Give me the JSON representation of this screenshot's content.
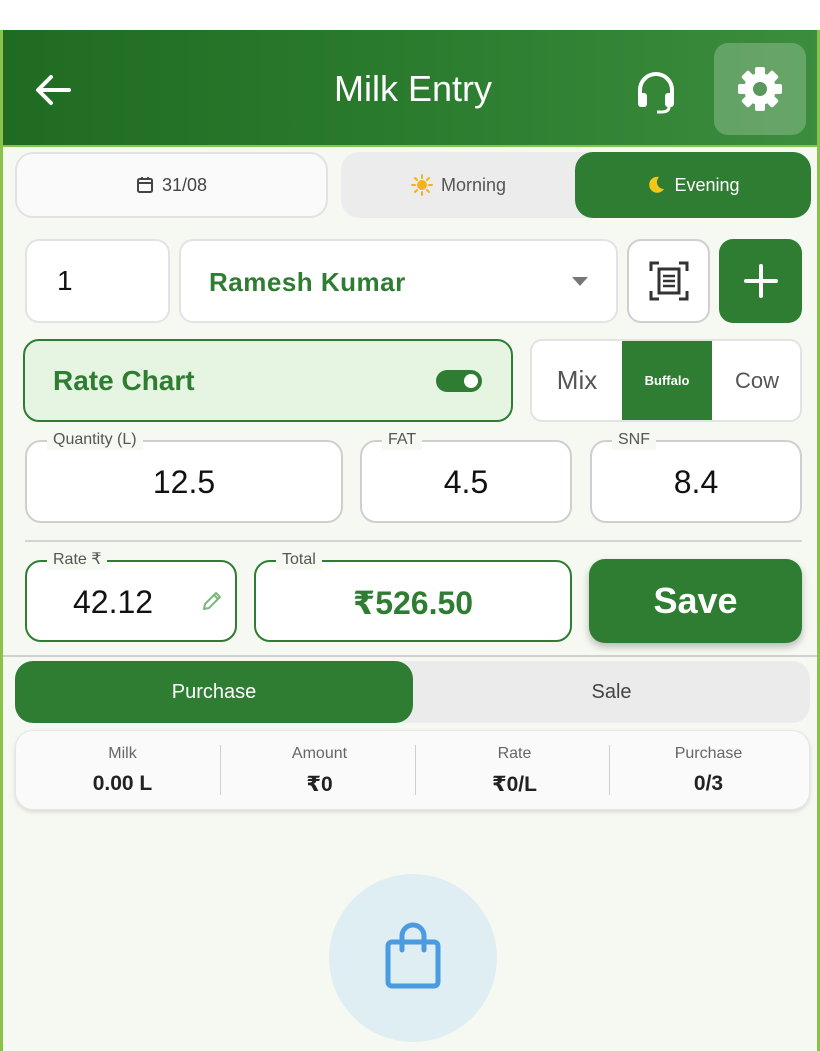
{
  "header": {
    "title": "Milk Entry"
  },
  "date": {
    "label": "31/08"
  },
  "shift": {
    "morning": "Morning",
    "evening": "Evening",
    "selected": "Evening"
  },
  "customer": {
    "number": "1",
    "name": "Ramesh Kumar"
  },
  "rate_chart": {
    "label": "Rate Chart",
    "enabled": true
  },
  "milk_type": {
    "options": [
      "Mix",
      "Buffalo",
      "Cow"
    ],
    "selected": "Buffalo"
  },
  "fields": {
    "quantity": {
      "label": "Quantity (L)",
      "value": "12.5"
    },
    "fat": {
      "label": "FAT",
      "value": "4.5"
    },
    "snf": {
      "label": "SNF",
      "value": "8.4"
    },
    "rate": {
      "label": "Rate ₹",
      "value": "42.12"
    },
    "total": {
      "label": "Total",
      "value": "₹526.50"
    }
  },
  "save_label": "Save",
  "tabs": {
    "purchase": "Purchase",
    "sale": "Sale",
    "selected": "Purchase"
  },
  "summary": [
    {
      "label": "Milk",
      "value": "0.00 L"
    },
    {
      "label": "Amount",
      "value": "₹0"
    },
    {
      "label": "Rate",
      "value": "₹0/L"
    },
    {
      "label": "Purchase",
      "value": "0/3"
    }
  ],
  "colors": {
    "primary": "#2e7d32",
    "accent_border": "#8bc34a",
    "background": "#f6f9f1",
    "empty_icon": "#4a9be0"
  },
  "icons": [
    "back-arrow-icon",
    "headset-icon",
    "gear-icon",
    "calendar-icon",
    "sun-icon",
    "moon-icon",
    "dropdown-caret-icon",
    "scan-icon",
    "plus-icon",
    "pencil-icon",
    "shopping-bag-icon"
  ]
}
